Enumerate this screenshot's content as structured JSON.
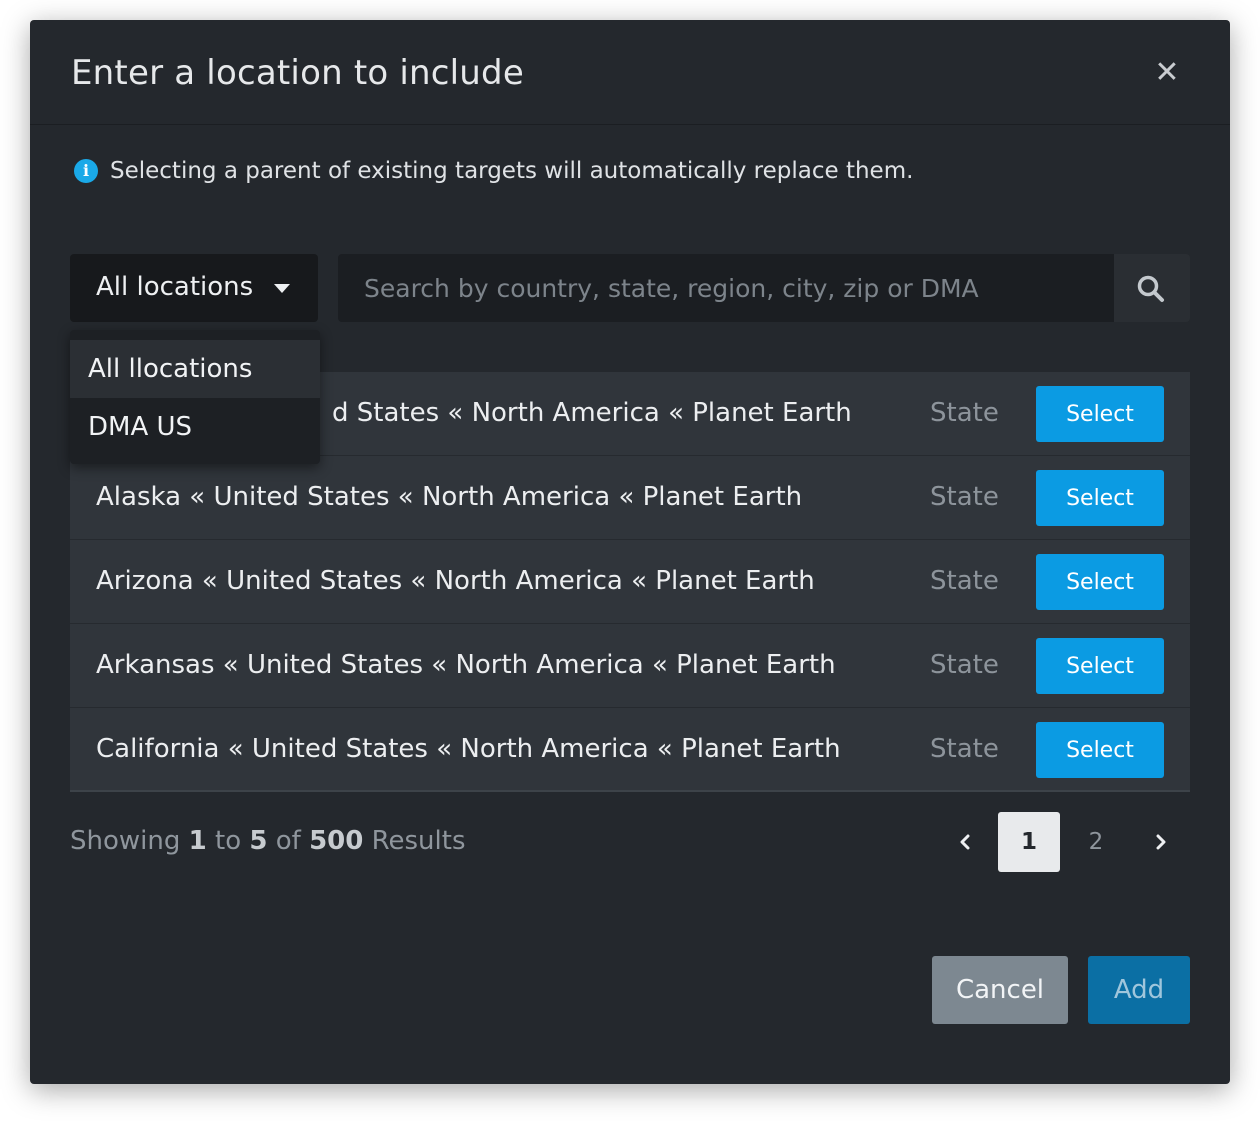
{
  "dialog": {
    "title": "Enter a location to include",
    "close_icon": "close-icon"
  },
  "info": {
    "icon": "info-icon",
    "icon_glyph": "i",
    "text": "Selecting a parent of existing targets will automatically replace them."
  },
  "filter": {
    "selected": "All locations",
    "options": [
      "All llocations",
      "DMA US"
    ]
  },
  "search": {
    "placeholder": "Search by country, state, region, city, zip or DMA",
    "value": "",
    "icon": "search-icon"
  },
  "results": [
    {
      "name": "Alabama « United States « North America « Planet Earth",
      "visible_name": "d States « North America « Planet Earth",
      "type": "State",
      "action": "Select"
    },
    {
      "name": "Alaska « United States « North America « Planet Earth",
      "type": "State",
      "action": "Select"
    },
    {
      "name": "Arizona « United States « North America « Planet Earth",
      "type": "State",
      "action": "Select"
    },
    {
      "name": "Arkansas « United States « North America « Planet Earth",
      "type": "State",
      "action": "Select"
    },
    {
      "name": "California « United States « North America « Planet Earth",
      "type": "State",
      "action": "Select"
    }
  ],
  "summary": {
    "prefix": "Showing",
    "from": "1",
    "to_word": "to",
    "to": "5",
    "of_word": "of",
    "total": "500",
    "suffix": "Results"
  },
  "pagination": {
    "current": "1",
    "next_page": "2",
    "prev_icon": "chevron-left-icon",
    "next_icon": "chevron-right-icon"
  },
  "actions": {
    "cancel": "Cancel",
    "add": "Add"
  },
  "colors": {
    "background": "#24282d",
    "accent": "#0b9be3",
    "info": "#1aa9e8"
  }
}
